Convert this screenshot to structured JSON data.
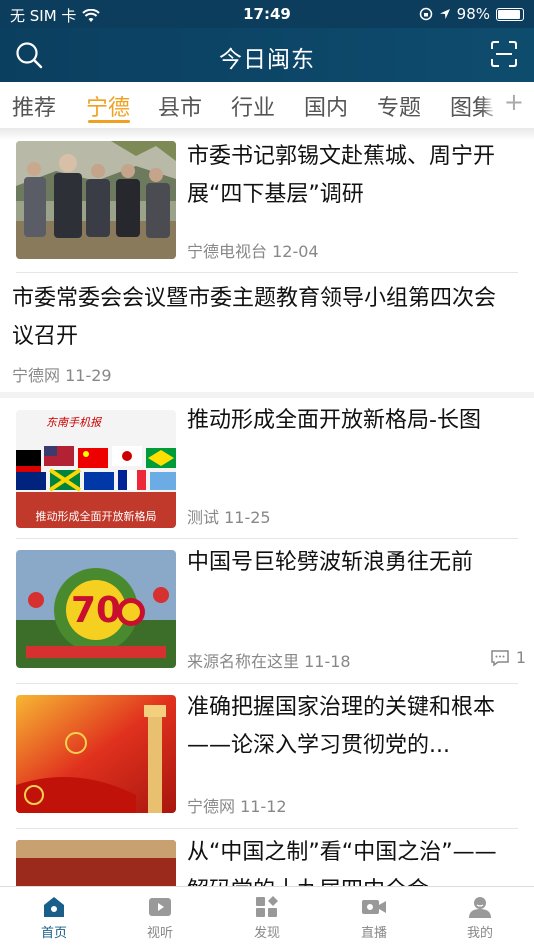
{
  "status": {
    "carrier": "无 SIM 卡",
    "time": "17:49",
    "battery": "98%"
  },
  "header": {
    "title": "今日闽东"
  },
  "tabs": [
    "推荐",
    "宁德",
    "县市",
    "行业",
    "国内",
    "专题",
    "图集"
  ],
  "active_tab": "宁德",
  "tab_plus": "+",
  "news": [
    {
      "title": "市委书记郭锡文赴蕉城、周宁开展“四下基层”调研",
      "source": "宁德电视台",
      "date": "12-04"
    },
    {
      "title": "市委常委会会议暨市委主题教育领导小组第四次会议召开",
      "source": "宁德网",
      "date": "11-29"
    },
    {
      "title": "推动形成全面开放新格局-长图",
      "source": "测试",
      "date": "11-25",
      "thumb_caption": "推动形成全面开放新格局",
      "thumb_logo": "东南手机报"
    },
    {
      "title": "中国号巨轮劈波斩浪勇往无前",
      "source": "来源名称在这里",
      "date": "11-18",
      "comments": "1"
    },
    {
      "title": "准确把握国家治理的关键和根本——论深入学习贯彻党的...",
      "source": "宁德网",
      "date": "11-12"
    },
    {
      "title": "从“中国之制”看“中国之治”——解码党的十九届四中全会",
      "source": "",
      "date": ""
    }
  ],
  "bottom_tabs": [
    "首页",
    "视听",
    "发现",
    "直播",
    "我的"
  ],
  "active_bottom_tab": "首页",
  "colors": {
    "header_bg": "#0d3d5c",
    "accent": "#f0a020",
    "tab_active": "#1a5f8a"
  }
}
